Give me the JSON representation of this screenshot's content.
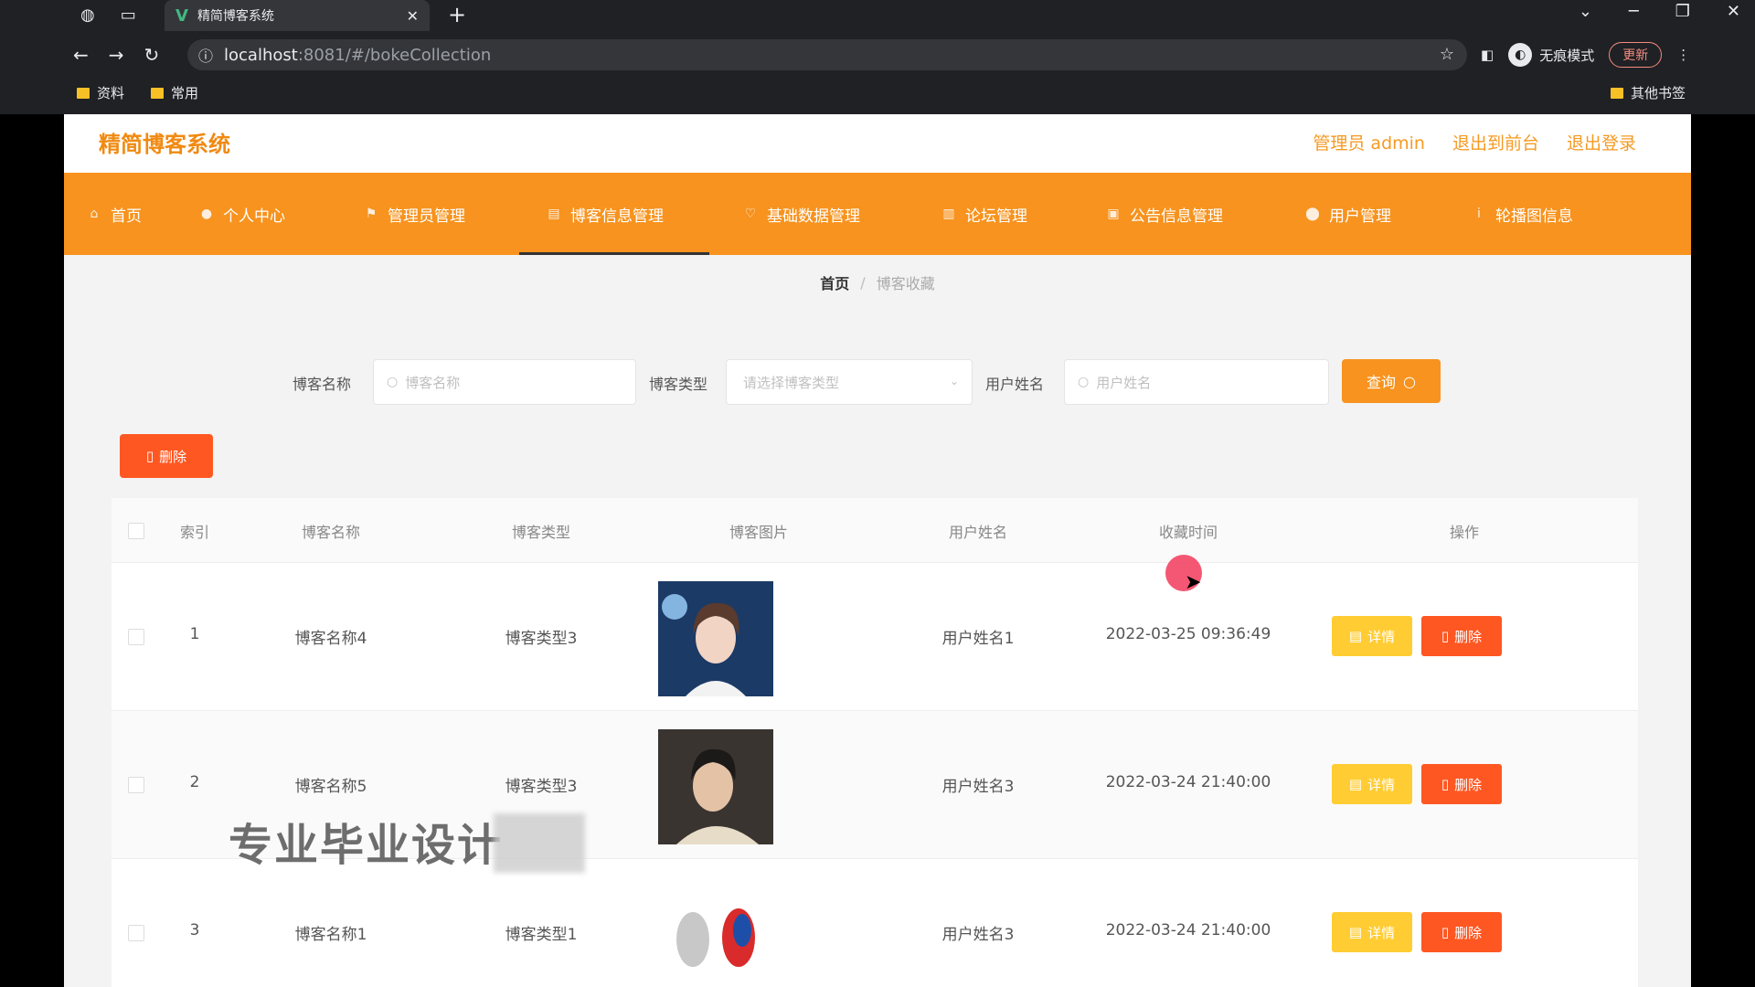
{
  "browser": {
    "tab_title": "精简博客系统",
    "url_host": "localhost",
    "url_rest": ":8081/#/bokeCollection",
    "incognito_label": "无痕模式",
    "update_label": "更新",
    "bookmarks": [
      "资料",
      "常用"
    ],
    "other_bookmarks": "其他书签"
  },
  "header": {
    "logo": "精简博客系统",
    "admin_label": "管理员 admin",
    "exit_front": "退出到前台",
    "logout": "退出登录"
  },
  "menu": [
    {
      "label": "首页",
      "icon": "home-icon"
    },
    {
      "label": "个人中心",
      "icon": "user-icon"
    },
    {
      "label": "管理员管理",
      "icon": "flag-icon"
    },
    {
      "label": "博客信息管理",
      "icon": "doc-icon"
    },
    {
      "label": "基础数据管理",
      "icon": "heart-icon"
    },
    {
      "label": "论坛管理",
      "icon": "chart-icon"
    },
    {
      "label": "公告信息管理",
      "icon": "image-icon"
    },
    {
      "label": "用户管理",
      "icon": "pin-icon"
    },
    {
      "label": "轮播图信息",
      "icon": "info-icon"
    }
  ],
  "breadcrumb": {
    "home": "首页",
    "current": "博客收藏"
  },
  "search": {
    "blog_name_label": "博客名称",
    "blog_name_placeholder": "博客名称",
    "blog_type_label": "博客类型",
    "blog_type_placeholder": "请选择博客类型",
    "user_name_label": "用户姓名",
    "user_name_placeholder": "用户姓名",
    "query_label": "查询"
  },
  "bulk_delete_label": "删除",
  "table": {
    "columns": [
      "索引",
      "博客名称",
      "博客类型",
      "博客图片",
      "用户姓名",
      "收藏时间",
      "操作"
    ],
    "rows": [
      {
        "index": "1",
        "name": "博客名称4",
        "type": "博客类型3",
        "user": "用户姓名1",
        "time": "2022-03-25 09:36:49"
      },
      {
        "index": "2",
        "name": "博客名称5",
        "type": "博客类型3",
        "user": "用户姓名3",
        "time": "2022-03-24 21:40:00"
      },
      {
        "index": "3",
        "name": "博客名称1",
        "type": "博客类型1",
        "user": "用户姓名3",
        "time": "2022-03-24 21:40:00"
      }
    ],
    "detail_label": "详情",
    "delete_label": "删除"
  },
  "watermark": "专业毕业设计",
  "colors": {
    "accent": "#f7931e",
    "danger": "#ff5722",
    "warning": "#ffcc33"
  }
}
